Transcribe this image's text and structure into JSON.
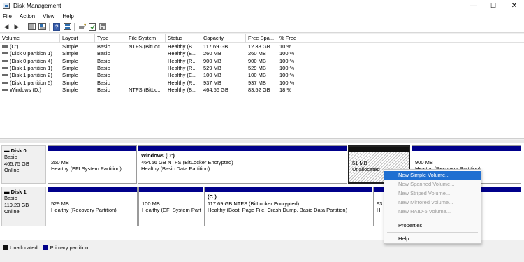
{
  "window": {
    "title": "Disk Management",
    "controls": {
      "minimize": "—",
      "maximize": "☐",
      "close": "✕"
    }
  },
  "menu": [
    "File",
    "Action",
    "View",
    "Help"
  ],
  "toolbar": {
    "back": "◀",
    "forward": "▶",
    "icons": [
      "list-view-icon",
      "properties-icon",
      "help-icon",
      "disk-view-icon",
      "connect-icon",
      "refresh-icon",
      "settings-icon"
    ]
  },
  "volumes": {
    "columns": [
      "Volume",
      "Layout",
      "Type",
      "File System",
      "Status",
      "Capacity",
      "Free Spa...",
      "% Free"
    ],
    "rows": [
      [
        "(C:)",
        "Simple",
        "Basic",
        "NTFS (BitLoc...",
        "Healthy (B...",
        "117.69 GB",
        "12.33 GB",
        "10 %"
      ],
      [
        "(Disk 0 partition 1)",
        "Simple",
        "Basic",
        "",
        "Healthy (E...",
        "260 MB",
        "260 MB",
        "100 %"
      ],
      [
        "(Disk 0 partition 4)",
        "Simple",
        "Basic",
        "",
        "Healthy (R...",
        "900 MB",
        "900 MB",
        "100 %"
      ],
      [
        "(Disk 1 partition 1)",
        "Simple",
        "Basic",
        "",
        "Healthy (R...",
        "529 MB",
        "529 MB",
        "100 %"
      ],
      [
        "(Disk 1 partition 2)",
        "Simple",
        "Basic",
        "",
        "Healthy (E...",
        "100 MB",
        "100 MB",
        "100 %"
      ],
      [
        "(Disk 1 partition 5)",
        "Simple",
        "Basic",
        "",
        "Healthy (R...",
        "937 MB",
        "937 MB",
        "100 %"
      ],
      [
        "Windows (D:)",
        "Simple",
        "Basic",
        "NTFS (BitLo...",
        "Healthy (B...",
        "464.56 GB",
        "83.52 GB",
        "18 %"
      ]
    ]
  },
  "disks": [
    {
      "name": "Disk 0",
      "type": "Basic",
      "size": "465.75 GB",
      "state": "Online",
      "partitions": [
        {
          "name": "",
          "size": "260 MB",
          "status": "Healthy (EFI System Partition)"
        },
        {
          "name": "Windows  (D:)",
          "size": "464.56 GB NTFS (BitLocker Encrypted)",
          "status": "Healthy (Basic Data Partition)"
        },
        {
          "name": "",
          "size": "51 MB",
          "status": "Unallocated"
        },
        {
          "name": "",
          "size": "900 MB",
          "status": "Healthy (Recovery Partition)"
        }
      ]
    },
    {
      "name": "Disk 1",
      "type": "Basic",
      "size": "119.23 GB",
      "state": "Online",
      "partitions": [
        {
          "name": "",
          "size": "529 MB",
          "status": "Healthy (Recovery Partition)"
        },
        {
          "name": "",
          "size": "100 MB",
          "status": "Healthy (EFI System Part"
        },
        {
          "name": "(C:)",
          "size": "117.69 GB NTFS (BitLocker Encrypted)",
          "status": "Healthy (Boot, Page File, Crash Dump, Basic Data Partition)"
        },
        {
          "name": "",
          "size": "93",
          "status": "H"
        }
      ]
    }
  ],
  "legend": [
    {
      "label": "Unallocated",
      "color": "#111111"
    },
    {
      "label": "Primary partition",
      "color": "#00008b"
    }
  ],
  "context_menu": {
    "items": [
      {
        "label": "New Simple Volume...",
        "state": "highlighted"
      },
      {
        "label": "New Spanned Volume...",
        "state": "disabled"
      },
      {
        "label": "New Striped Volume...",
        "state": "disabled"
      },
      {
        "label": "New Mirrored Volume...",
        "state": "disabled"
      },
      {
        "label": "New RAID-5 Volume...",
        "state": "disabled"
      },
      {
        "label": "Properties",
        "state": "enabled"
      },
      {
        "label": "Help",
        "state": "enabled"
      }
    ]
  },
  "colors": {
    "primary_partition": "#00008b",
    "unallocated": "#111111",
    "menu_highlight": "#1f6fd1"
  }
}
